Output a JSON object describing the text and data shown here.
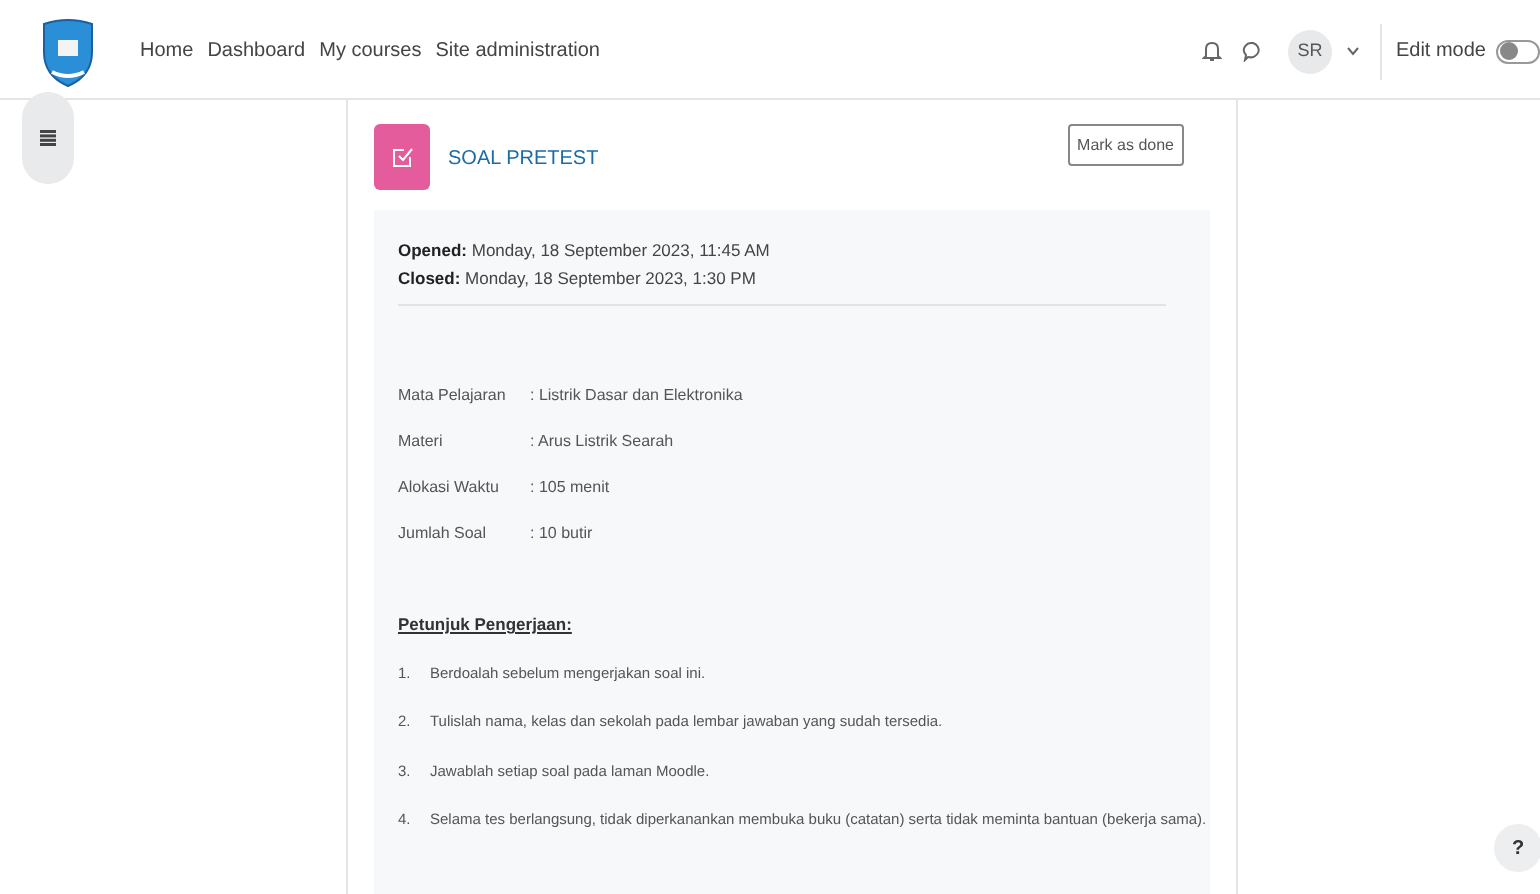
{
  "navbar": {
    "links": [
      "Home",
      "Dashboard",
      "My courses",
      "Site administration"
    ],
    "avatar": "SR",
    "edit_mode": {
      "label": "Edit mode",
      "on": false
    }
  },
  "activity": {
    "title": "SOAL PRETEST",
    "mark_button": "Mark as done",
    "dates": [
      {
        "label": "Opened:",
        "value": "Monday, 18 September 2023, 11:45 AM"
      },
      {
        "label": "Closed:",
        "value": "Monday, 18 September 2023, 1:30 PM"
      }
    ],
    "info": [
      {
        "label": "Mata Pelajaran",
        "value": ": Listrik Dasar dan Elektronika"
      },
      {
        "label": "Materi",
        "value": ": Arus Listrik Searah"
      },
      {
        "label": "Alokasi Waktu",
        "value": ": 105 menit"
      },
      {
        "label": "Jumlah Soal",
        "value": ": 10 butir"
      }
    ],
    "instructions_title": "Petunjuk Pengerjaan:",
    "instructions": [
      {
        "number": "1.",
        "text": "Berdoalah sebelum mengerjakan soal ini."
      },
      {
        "number": "2.",
        "text": "Tulislah nama, kelas dan sekolah pada lembar jawaban yang sudah tersedia."
      },
      {
        "number": "3.",
        "text": "Jawablah setiap soal pada laman Moodle."
      },
      {
        "number": "4.",
        "text": "Selama tes berlangsung, tidak diperkanankan membuka buku (catatan) serta tidak meminta bantuan (bekerja sama)."
      }
    ]
  },
  "help_button": "?"
}
